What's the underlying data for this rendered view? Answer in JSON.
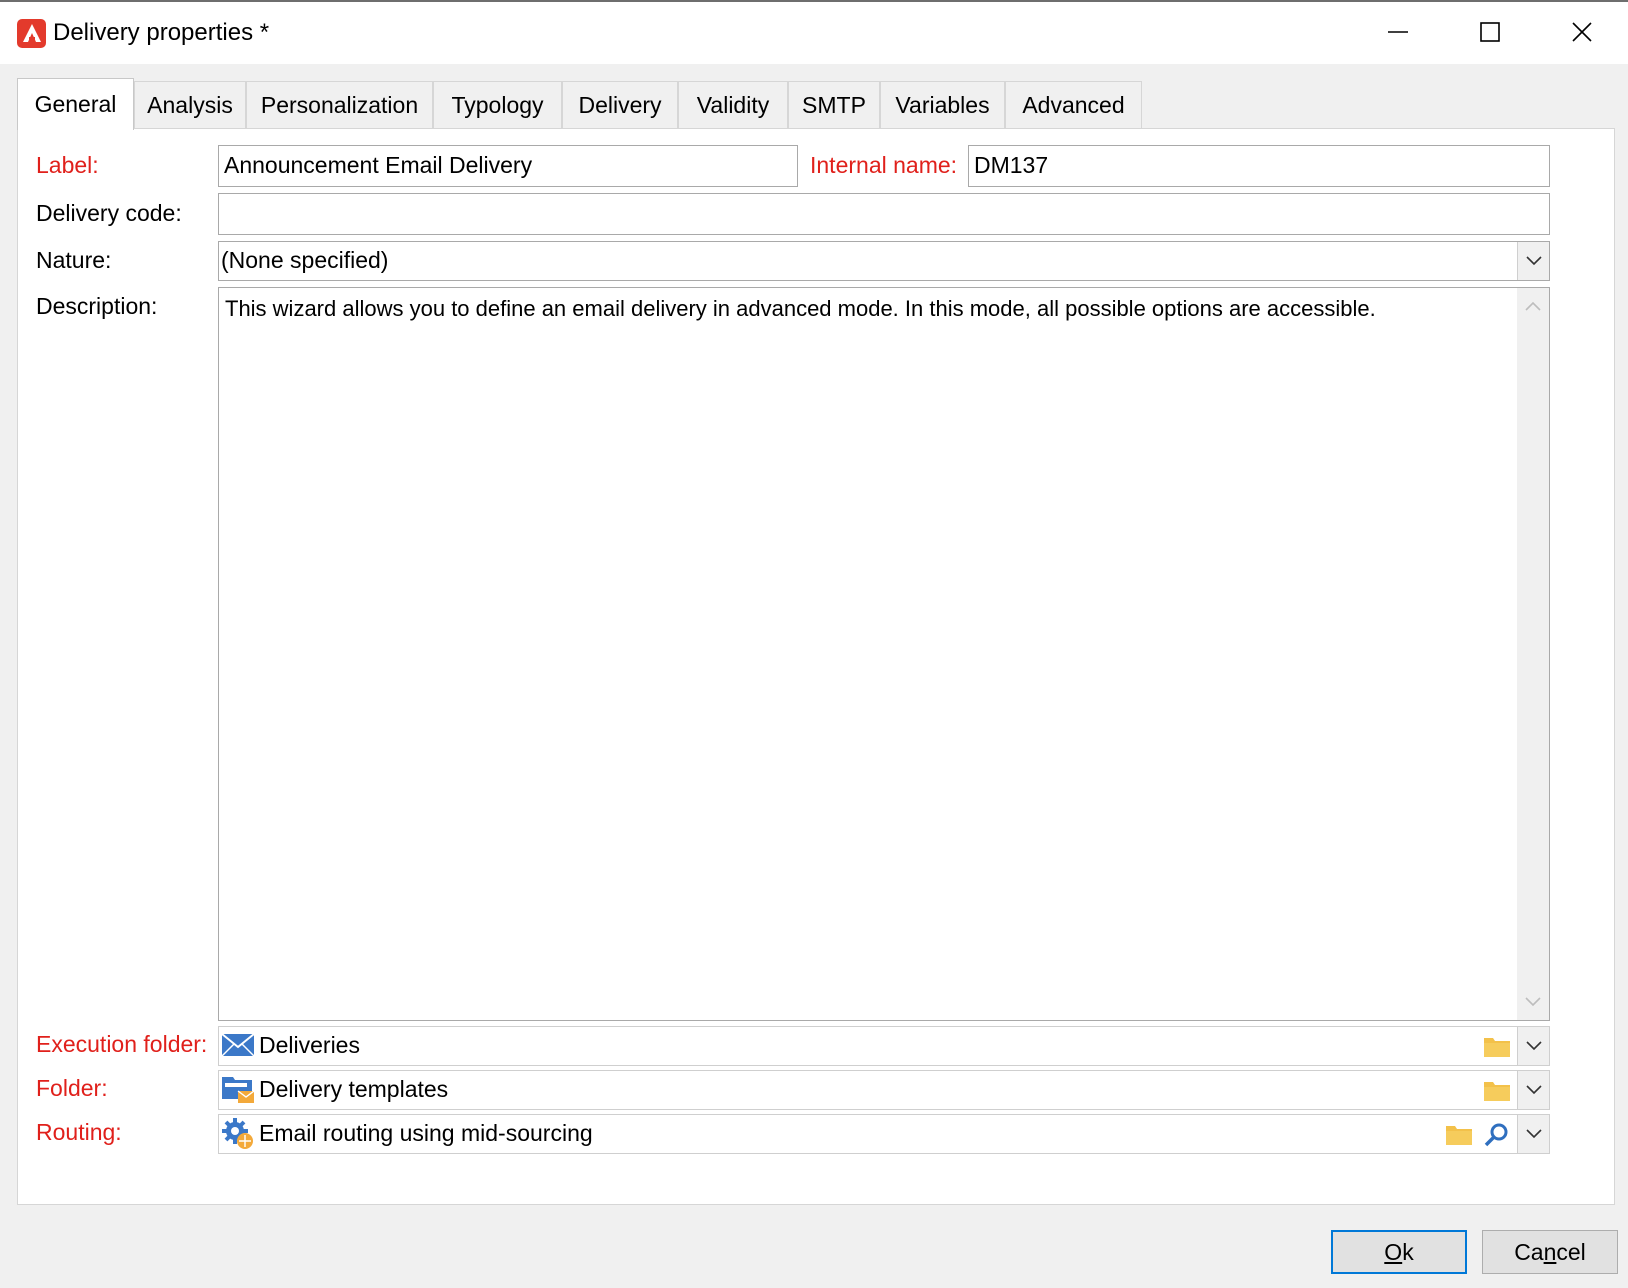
{
  "window": {
    "title": "Delivery properties *"
  },
  "tabs": [
    {
      "label": "General",
      "active": true
    },
    {
      "label": "Analysis",
      "active": false
    },
    {
      "label": "Personalization",
      "active": false
    },
    {
      "label": "Typology",
      "active": false
    },
    {
      "label": "Delivery",
      "active": false
    },
    {
      "label": "Validity",
      "active": false
    },
    {
      "label": "SMTP",
      "active": false
    },
    {
      "label": "Variables",
      "active": false
    },
    {
      "label": "Advanced",
      "active": false
    }
  ],
  "general": {
    "label_caption": "Label:",
    "label_value": "Announcement Email Delivery",
    "internal_name_caption": "Internal name:",
    "internal_name_value": "DM137",
    "delivery_code_caption": "Delivery code:",
    "delivery_code_value": "",
    "nature_caption": "Nature:",
    "nature_value": "(None specified)",
    "description_caption": "Description:",
    "description_value": "This wizard allows you to define an email delivery in advanced mode. In this mode, all possible options are accessible.",
    "execution_folder_caption": "Execution folder:",
    "execution_folder_value": "Deliveries",
    "execution_folder_icon": "envelope-folder-icon",
    "folder_caption": "Folder:",
    "folder_value": "Delivery templates",
    "folder_icon": "template-folder-icon",
    "routing_caption": "Routing:",
    "routing_value": "Email routing using mid-sourcing",
    "routing_icon": "routing-gear-icon"
  },
  "buttons": {
    "ok_prefix": "O",
    "ok_rest": "k",
    "cancel_prefix": "Ca",
    "cancel_underlined": "n",
    "cancel_rest": "cel"
  },
  "colors": {
    "required_label": "#e0201b",
    "default_button_border": "#0078d7",
    "app_icon": "#e33a2c",
    "folder_yellow": "#f3c14a",
    "envelope_blue": "#3b78c8"
  }
}
